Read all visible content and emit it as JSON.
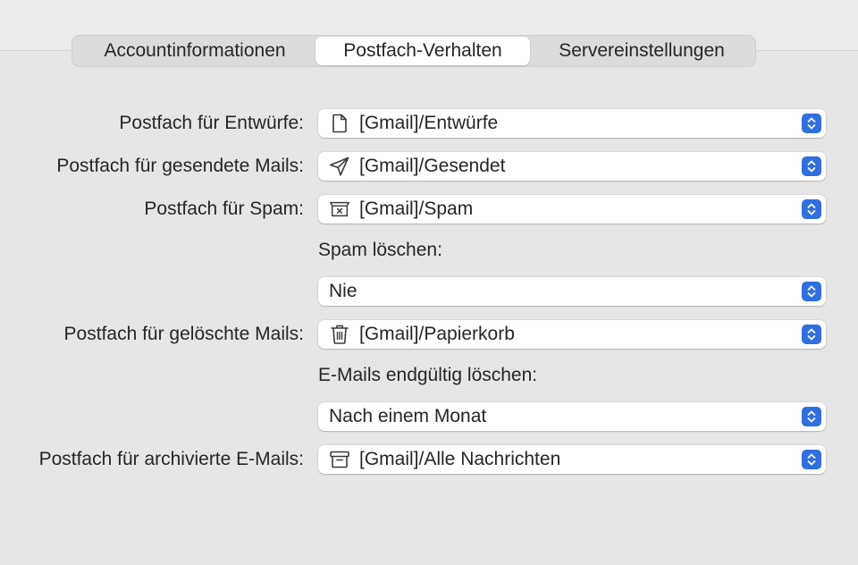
{
  "tabs": [
    {
      "label": "Accountinformationen",
      "selected": false
    },
    {
      "label": "Postfach-Verhalten",
      "selected": true
    },
    {
      "label": "Servereinstellungen",
      "selected": false
    }
  ],
  "rows": {
    "drafts": {
      "label": "Postfach für Entwürfe:",
      "value": "[Gmail]/Entwürfe",
      "icon": "document-icon"
    },
    "sent": {
      "label": "Postfach für gesendete Mails:",
      "value": "[Gmail]/Gesendet",
      "icon": "paper-plane-icon"
    },
    "spam": {
      "label": "Postfach für Spam:",
      "value": "[Gmail]/Spam",
      "icon": "junk-box-icon"
    },
    "spam_delete": {
      "label": "Spam löschen:",
      "value": "Nie"
    },
    "trash": {
      "label": "Postfach für gelöschte Mails:",
      "value": "[Gmail]/Papierkorb",
      "icon": "trash-icon"
    },
    "erase": {
      "label": "E-Mails endgültig löschen:",
      "value": "Nach einem Monat"
    },
    "archive": {
      "label": "Postfach für archivierte E-Mails:",
      "value": "[Gmail]/Alle Nachrichten",
      "icon": "archive-box-icon"
    }
  },
  "colors": {
    "accent": "#2f6fe0",
    "background": "#e6e6e6",
    "control": "#ffffff"
  }
}
